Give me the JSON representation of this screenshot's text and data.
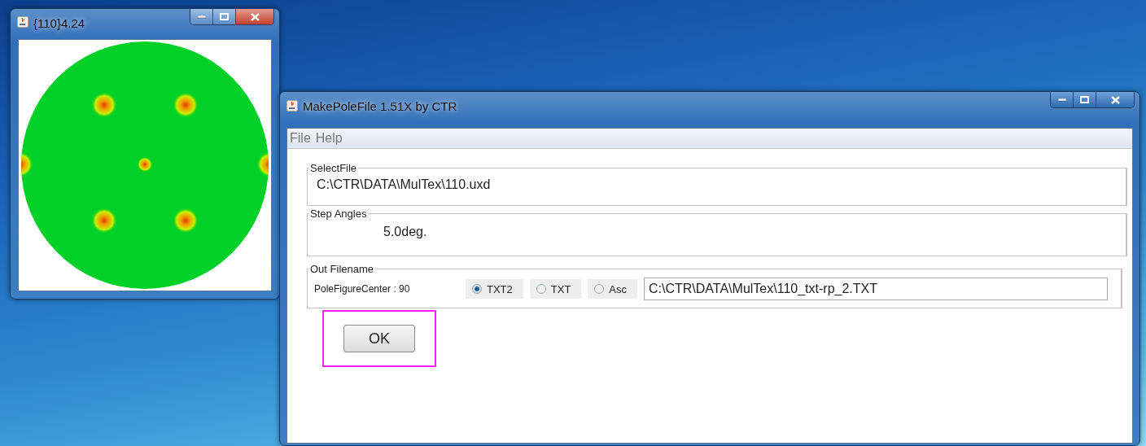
{
  "figure_window": {
    "title": "{110}4.24"
  },
  "main_window": {
    "title": "MakePoleFile 1.51X by CTR"
  },
  "menu": [
    "File",
    "Help"
  ],
  "select_file": {
    "legend": "SelectFile",
    "value": "C:\\CTR\\DATA\\MulTex\\110.uxd"
  },
  "step_angles": {
    "legend": "Step Angles",
    "value": "5.0deg."
  },
  "out_filename": {
    "legend": "Out Filename",
    "center_label": "PoleFigureCenter : 90",
    "formats": [
      {
        "label": "TXT2",
        "selected": true
      },
      {
        "label": "TXT",
        "selected": false
      },
      {
        "label": "Asc",
        "selected": false
      }
    ],
    "value": "C:\\CTR\\DATA\\MulTex\\110_txt-rp_2.TXT"
  },
  "ok_button": {
    "label": "OK",
    "highlighted": true
  }
}
